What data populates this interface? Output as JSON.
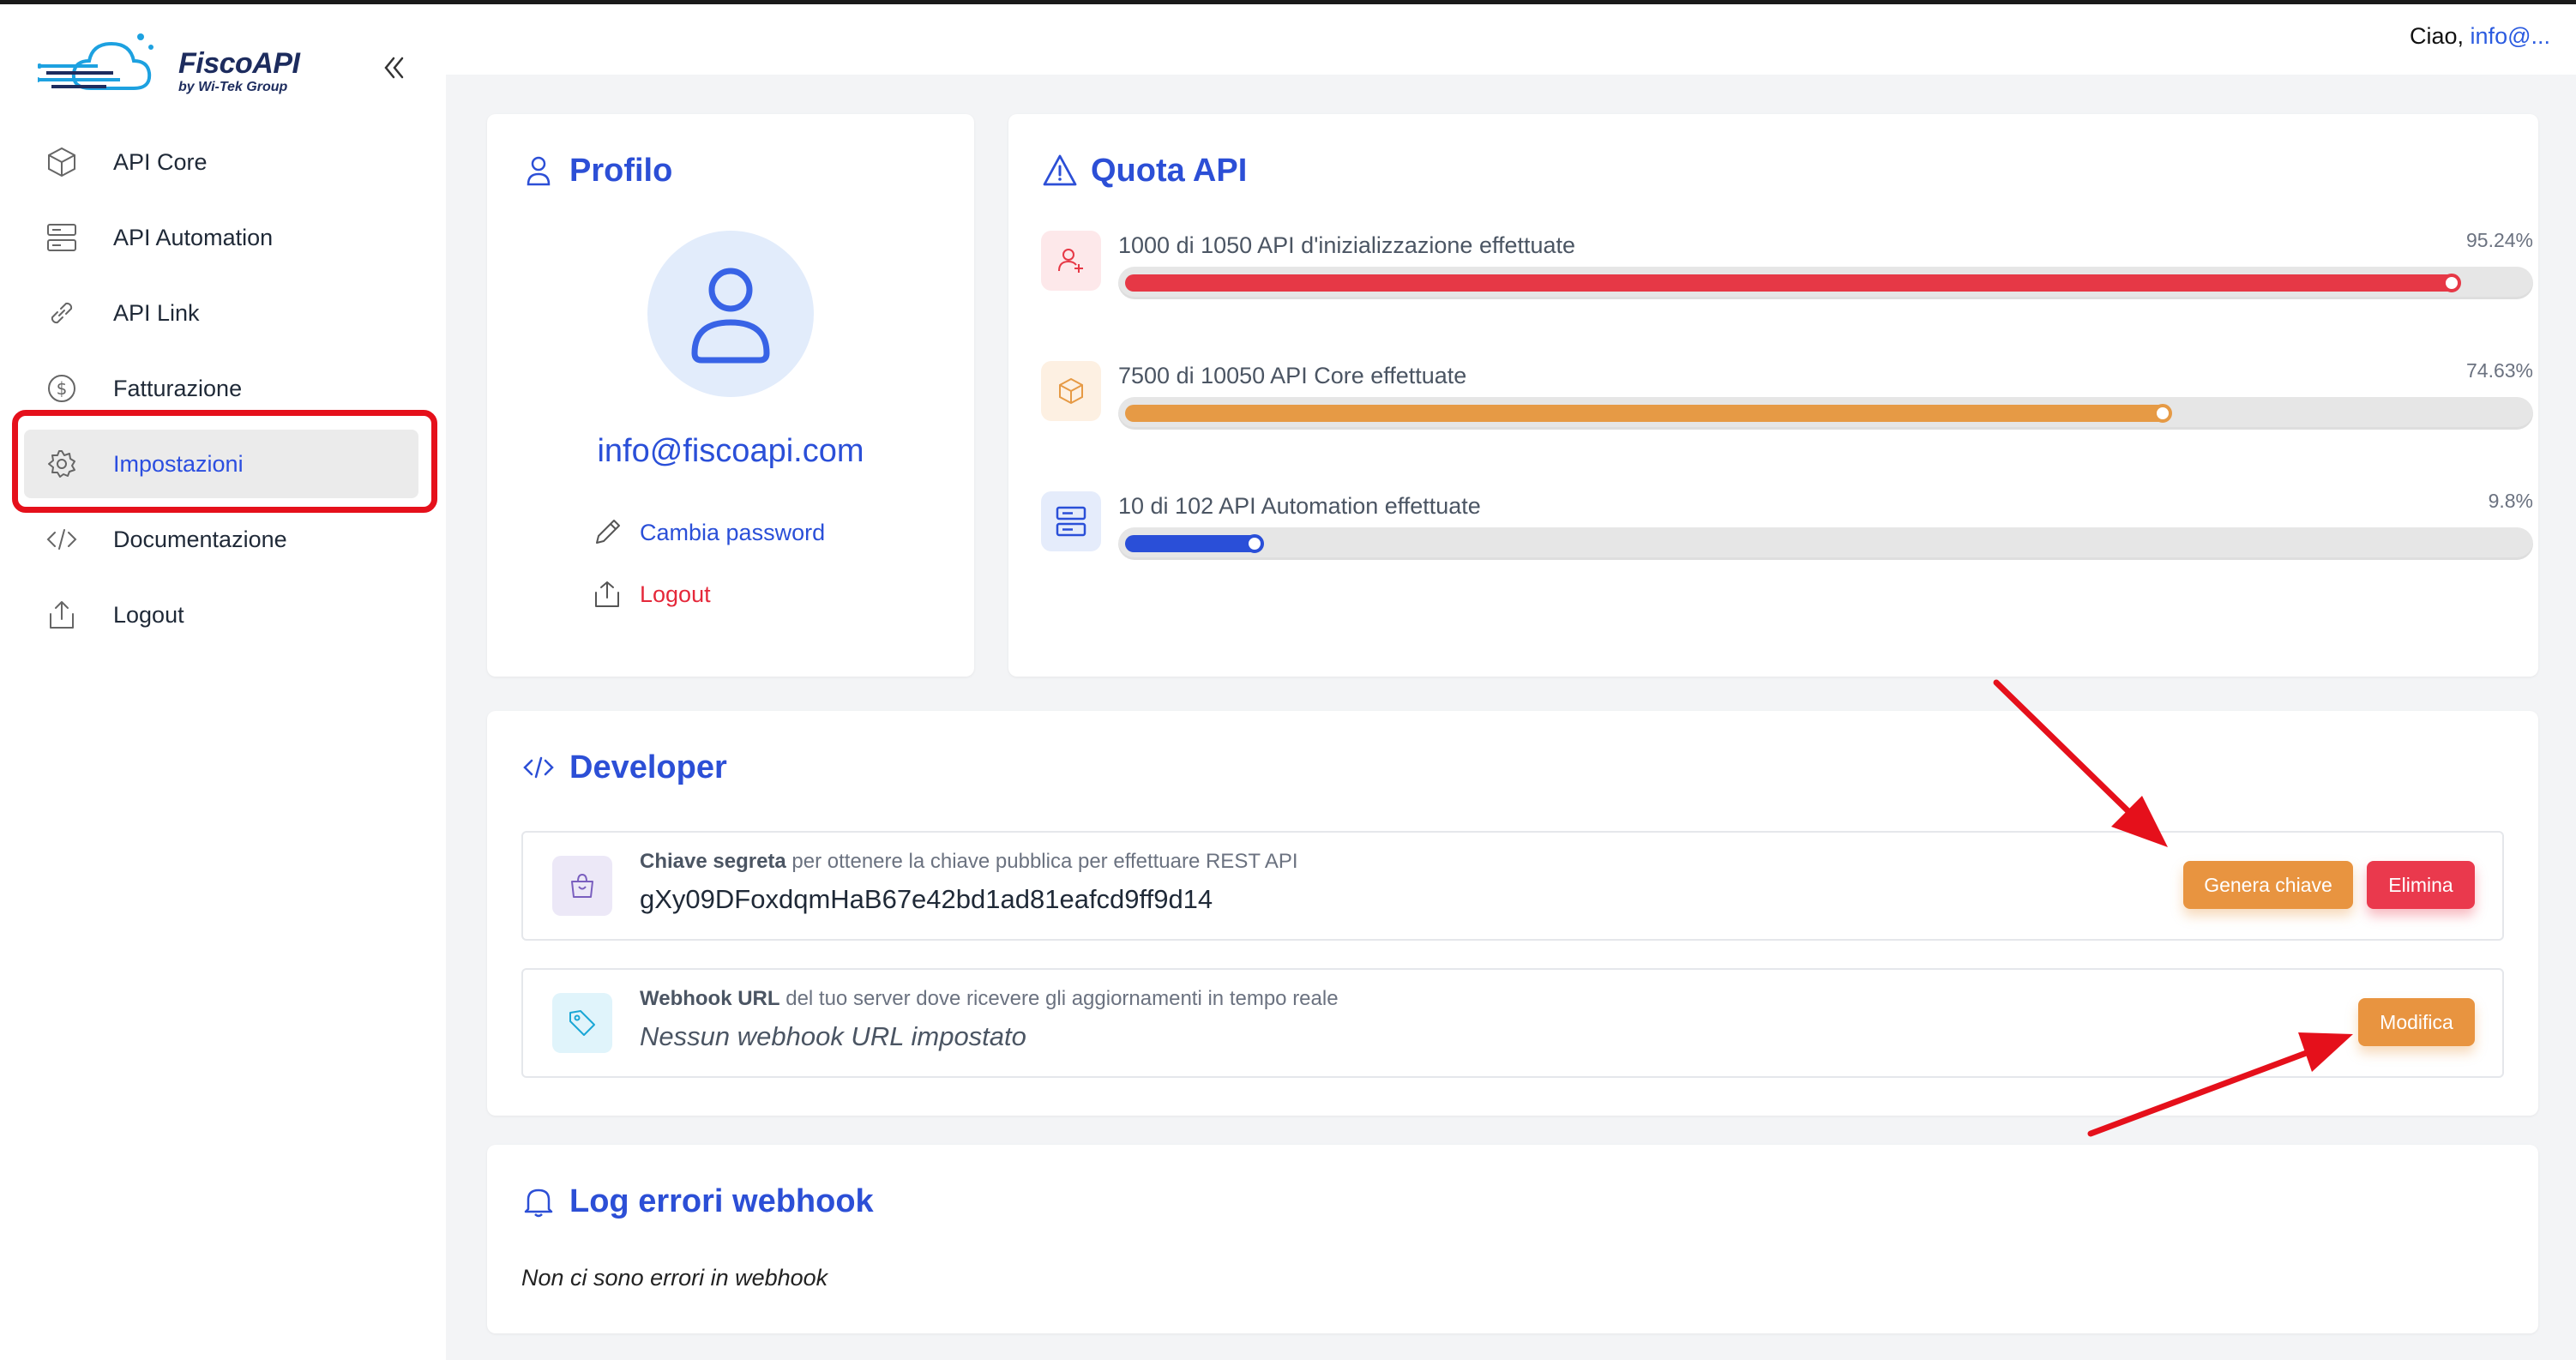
{
  "brand": {
    "name": "FiscoAPI",
    "subtitle": "by Wi-Tek Group"
  },
  "header": {
    "greeting": "Ciao,",
    "user": "info@..."
  },
  "sidebar": {
    "items": [
      {
        "label": "API Core",
        "icon": "cube-icon",
        "active": false
      },
      {
        "label": "API Automation",
        "icon": "server-icon",
        "active": false
      },
      {
        "label": "API Link",
        "icon": "link-icon",
        "active": false
      },
      {
        "label": "Fatturazione",
        "icon": "dollar-icon",
        "active": false
      },
      {
        "label": "Impostazioni",
        "icon": "gear-icon",
        "active": true
      },
      {
        "label": "Documentazione",
        "icon": "code-icon",
        "active": false
      },
      {
        "label": "Logout",
        "icon": "upload-icon",
        "active": false
      }
    ]
  },
  "profile": {
    "title": "Profilo",
    "email": "info@fiscoapi.com",
    "change_password": "Cambia password",
    "logout": "Logout"
  },
  "quota": {
    "title": "Quota API",
    "rows": [
      {
        "label": "1000 di 1050 API d'inizializzazione effettuate",
        "percent_text": "95.24%",
        "percent": 95.24,
        "color": "#e63846",
        "icon": "user-plus-icon"
      },
      {
        "label": "7500 di 10050 API Core effettuate",
        "percent_text": "74.63%",
        "percent": 74.63,
        "color": "#e69a45",
        "icon": "cube-icon"
      },
      {
        "label": "10 di 102 API Automation effettuate",
        "percent_text": "9.8%",
        "percent": 9.8,
        "color": "#2a4fd8",
        "icon": "server-icon"
      }
    ]
  },
  "developer": {
    "title": "Developer",
    "secret": {
      "label_bold": "Chiave segreta",
      "label_rest": " per ottenere la chiave pubblica per effettuare REST API",
      "value": "gXy09DFoxdqmHaB67e42bd1ad81eafcd9ff9d14",
      "generate": "Genera chiave",
      "delete": "Elimina"
    },
    "webhook": {
      "label_bold": "Webhook URL",
      "label_rest": " del tuo server dove ricevere gli aggiornamenti in tempo reale",
      "value": "Nessun webhook URL impostato",
      "edit": "Modifica"
    }
  },
  "log": {
    "title": "Log errori webhook",
    "empty": "Non ci sono errori in webhook"
  },
  "colors": {
    "accent": "#2c4fd6",
    "orange": "#e89440",
    "red": "#ea394d",
    "annotation": "#e5101b"
  }
}
